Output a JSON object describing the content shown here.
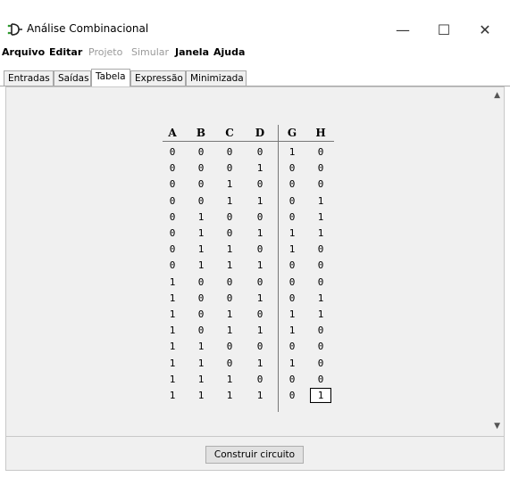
{
  "window": {
    "title": "Análise Combinacional",
    "minimize_glyph": "—",
    "maximize_glyph": "☐",
    "close_glyph": "✕"
  },
  "menu": [
    {
      "label": "Arquivo",
      "enabled": true
    },
    {
      "label": "Editar",
      "enabled": true
    },
    {
      "label": "Projeto",
      "enabled": false
    },
    {
      "label": "Simular",
      "enabled": false
    },
    {
      "label": "Janela",
      "enabled": true
    },
    {
      "label": "Ajuda",
      "enabled": true
    }
  ],
  "tabs": [
    {
      "label": "Entradas",
      "active": false
    },
    {
      "label": "Saídas",
      "active": false
    },
    {
      "label": "Tabela",
      "active": true
    },
    {
      "label": "Expressão",
      "active": false
    },
    {
      "label": "Minimizada",
      "active": false
    }
  ],
  "truth_table": {
    "input_headers": [
      "A",
      "B",
      "C",
      "D"
    ],
    "output_headers": [
      "G",
      "H"
    ],
    "rows": [
      [
        "0",
        "0",
        "0",
        "0",
        "1",
        "0"
      ],
      [
        "0",
        "0",
        "0",
        "1",
        "0",
        "0"
      ],
      [
        "0",
        "0",
        "1",
        "0",
        "0",
        "0"
      ],
      [
        "0",
        "0",
        "1",
        "1",
        "0",
        "1"
      ],
      [
        "0",
        "1",
        "0",
        "0",
        "0",
        "1"
      ],
      [
        "0",
        "1",
        "0",
        "1",
        "1",
        "1"
      ],
      [
        "0",
        "1",
        "1",
        "0",
        "1",
        "0"
      ],
      [
        "0",
        "1",
        "1",
        "1",
        "0",
        "0"
      ],
      [
        "1",
        "0",
        "0",
        "0",
        "0",
        "0"
      ],
      [
        "1",
        "0",
        "0",
        "1",
        "0",
        "1"
      ],
      [
        "1",
        "0",
        "1",
        "0",
        "1",
        "1"
      ],
      [
        "1",
        "0",
        "1",
        "1",
        "1",
        "0"
      ],
      [
        "1",
        "1",
        "0",
        "0",
        "0",
        "0"
      ],
      [
        "1",
        "1",
        "0",
        "1",
        "1",
        "0"
      ],
      [
        "1",
        "1",
        "1",
        "0",
        "0",
        "0"
      ],
      [
        "1",
        "1",
        "1",
        "1",
        "0",
        "1"
      ]
    ],
    "selected_row": 15,
    "selected_col": 5
  },
  "buttons": {
    "build_circuit": "Construir circuito"
  },
  "icons": {
    "app": "logisim-gate-icon",
    "scroll_up": "chevron-up-icon",
    "scroll_down": "chevron-down-icon"
  }
}
